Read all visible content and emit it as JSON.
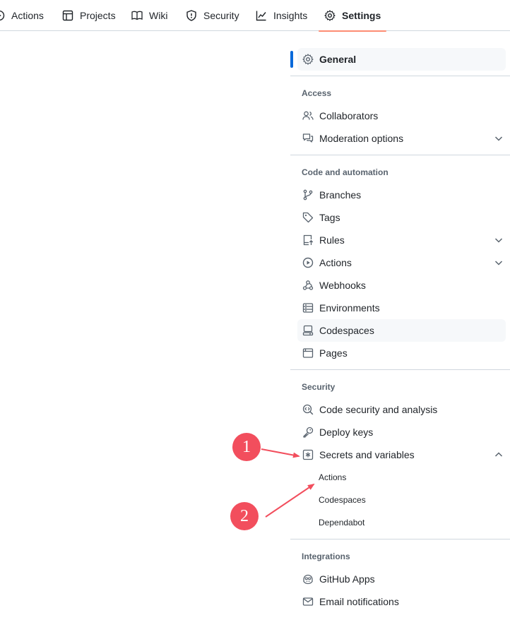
{
  "tabs": [
    {
      "label": "Actions",
      "icon": "play-circle-icon"
    },
    {
      "label": "Projects",
      "icon": "table-icon"
    },
    {
      "label": "Wiki",
      "icon": "book-icon"
    },
    {
      "label": "Security",
      "icon": "shield-icon"
    },
    {
      "label": "Insights",
      "icon": "graph-icon"
    },
    {
      "label": "Settings",
      "icon": "gear-icon",
      "selected": true
    }
  ],
  "sidebar": {
    "general": {
      "label": "General",
      "icon": "gear-icon",
      "active": true
    },
    "access": {
      "heading": "Access",
      "items": [
        {
          "label": "Collaborators",
          "icon": "people-icon"
        },
        {
          "label": "Moderation options",
          "icon": "comment-discussion-icon",
          "expandable": true
        }
      ]
    },
    "code_automation": {
      "heading": "Code and automation",
      "items": [
        {
          "label": "Branches",
          "icon": "git-branch-icon"
        },
        {
          "label": "Tags",
          "icon": "tag-icon"
        },
        {
          "label": "Rules",
          "icon": "repo-push-icon",
          "expandable": true
        },
        {
          "label": "Actions",
          "icon": "play-circle-icon",
          "expandable": true
        },
        {
          "label": "Webhooks",
          "icon": "webhook-icon"
        },
        {
          "label": "Environments",
          "icon": "server-icon"
        },
        {
          "label": "Codespaces",
          "icon": "codespaces-icon",
          "hovered": true
        },
        {
          "label": "Pages",
          "icon": "browser-icon"
        }
      ]
    },
    "security": {
      "heading": "Security",
      "items": [
        {
          "label": "Code security and analysis",
          "icon": "codescan-icon"
        },
        {
          "label": "Deploy keys",
          "icon": "key-icon"
        },
        {
          "label": "Secrets and variables",
          "icon": "key-asterisk-icon",
          "expanded": true
        }
      ],
      "subitems": [
        "Actions",
        "Codespaces",
        "Dependabot"
      ]
    },
    "integrations": {
      "heading": "Integrations",
      "items": [
        {
          "label": "GitHub Apps",
          "icon": "copilot-icon"
        },
        {
          "label": "Email notifications",
          "icon": "mail-icon"
        }
      ]
    }
  },
  "annotations": {
    "badge1": "1",
    "badge2": "2",
    "color": "#f24e5d"
  },
  "colors": {
    "active_indicator": "#0969da",
    "selected_tab_underline": "#fd8c73",
    "divider": "#d0d7de"
  }
}
